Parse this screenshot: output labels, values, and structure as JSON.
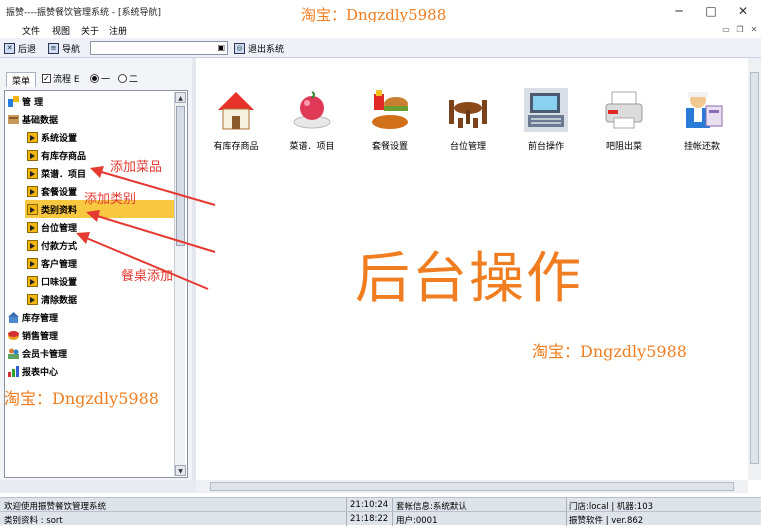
{
  "window": {
    "title": "振赞----振赞餐饮管理系统 - [系统导航]",
    "controls": [
      "─",
      "□",
      "✕"
    ]
  },
  "watermark": {
    "text": "淘宝：Dngzdly5988"
  },
  "menubar": {
    "items": [
      "文件",
      "视图",
      "关于",
      "注册"
    ]
  },
  "toolbar": {
    "back_label": "后退",
    "nav_label": "导航",
    "exit_label": "退出系统",
    "search_value": ""
  },
  "left_panel": {
    "tab_menu": "菜单",
    "tab_flow": "流程 E",
    "radio_one": "一",
    "radio_two": "二",
    "tree": [
      {
        "label": "管  理",
        "level": 0,
        "icon": "manage-icon"
      },
      {
        "label": "基础数据",
        "level": 0,
        "icon": "database-icon"
      },
      {
        "label": "系统设置",
        "level": 1
      },
      {
        "label": "有库存商品",
        "level": 1
      },
      {
        "label": "菜谱．项目",
        "level": 1
      },
      {
        "label": "套餐设置",
        "level": 1
      },
      {
        "label": "类别资料",
        "level": 1,
        "selected": true
      },
      {
        "label": "台位管理",
        "level": 1
      },
      {
        "label": "付款方式",
        "level": 1
      },
      {
        "label": "客户管理",
        "level": 1
      },
      {
        "label": "口味设置",
        "level": 1
      },
      {
        "label": "清除数据",
        "level": 1
      },
      {
        "label": "库存管理",
        "level": 0,
        "icon": "warehouse-icon"
      },
      {
        "label": "销售管理",
        "level": 0,
        "icon": "sales-icon"
      },
      {
        "label": "会员卡管理",
        "level": 0,
        "icon": "members-icon"
      },
      {
        "label": "报表中心",
        "level": 0,
        "icon": "report-icon"
      }
    ]
  },
  "main": {
    "icons": [
      {
        "label": "有库存商品",
        "icon": "house-icon"
      },
      {
        "label": "菜谱．项目",
        "icon": "dish-icon"
      },
      {
        "label": "套餐设置",
        "icon": "combo-meal-icon"
      },
      {
        "label": "台位管理",
        "icon": "dining-table-icon"
      },
      {
        "label": "前台操作",
        "icon": "cash-register-icon"
      },
      {
        "label": "吧阻出菜",
        "icon": "printer-icon"
      },
      {
        "label": "挂帐还款",
        "icon": "cashier-person-icon"
      }
    ],
    "big_title": "后台操作"
  },
  "annotations": [
    "添加菜品",
    "添加类别",
    "餐桌添加"
  ],
  "status_bar": {
    "row1": {
      "message": "欢迎使用振赞餐饮管理系统",
      "time": "21:10:24",
      "info": "套帐信息:系统默认",
      "store": "门店:local | 机器:103"
    },
    "row2": {
      "message": "类别资料 : sort",
      "time": "21:18:22",
      "user": "用户:0001",
      "version": "振赞软件 | ver.862"
    }
  },
  "colors": {
    "accent_orange": "#f07d1f",
    "annotation_red": "#e53a32",
    "selected_row": "#f8c840"
  }
}
